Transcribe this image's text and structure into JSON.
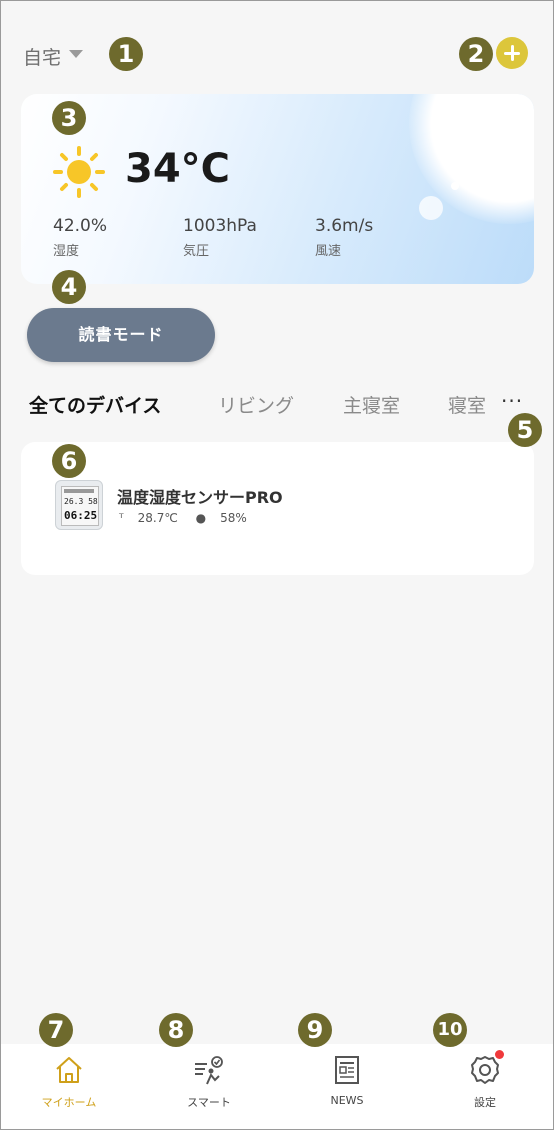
{
  "header": {
    "home_label": "自宅",
    "add_button_color": "#dcc63b"
  },
  "weather": {
    "temperature": "34°C",
    "icon": "sun-icon",
    "humidity_value": "42.0%",
    "humidity_label": "湿度",
    "pressure_value": "1003hPa",
    "pressure_label": "気圧",
    "wind_value": "3.6m/s",
    "wind_label": "風速"
  },
  "scene_button": {
    "label": "読書モード",
    "color": "#6b7a8e"
  },
  "tabs": [
    {
      "label": "全てのデバイス",
      "active": true
    },
    {
      "label": "リビング",
      "active": false
    },
    {
      "label": "主寝室",
      "active": false
    },
    {
      "label": "寝室",
      "active": false
    }
  ],
  "tabs_more": "···",
  "devices": [
    {
      "name": "温度湿度センサーPRO",
      "temperature": "28.7℃",
      "humidity": "58%",
      "screen_top": "26.3 58",
      "screen_time": "06:25"
    }
  ],
  "bottom_nav": [
    {
      "label": "マイホーム",
      "icon": "home-icon",
      "active": true
    },
    {
      "label": "スマート",
      "icon": "smart-scene-icon",
      "active": false
    },
    {
      "label": "NEWS",
      "icon": "news-icon",
      "active": false
    },
    {
      "label": "設定",
      "icon": "gear-icon",
      "active": false
    }
  ],
  "markers": [
    "1",
    "2",
    "3",
    "4",
    "5",
    "6",
    "7",
    "8",
    "9",
    "10"
  ],
  "colors": {
    "accent": "#cfa01a",
    "marker": "#6e6a2d",
    "badge": "#f0393b"
  }
}
